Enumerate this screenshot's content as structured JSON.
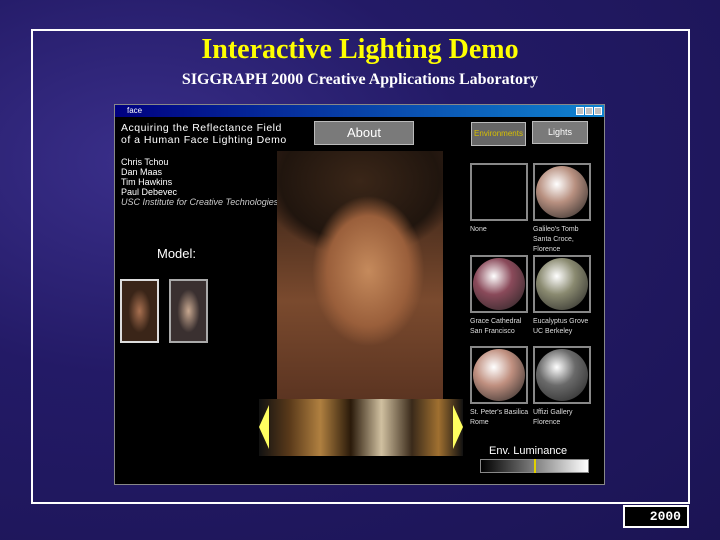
{
  "slide": {
    "title": "Interactive Lighting Demo",
    "subtitle": "SIGGRAPH 2000 Creative Applications Laboratory",
    "logo_text": "2000"
  },
  "window": {
    "title": "face",
    "app_title_1": "Acquiring the Reflectance Field",
    "app_title_2": "of a Human Face Lighting Demo",
    "authors": [
      "Chris Tchou",
      "Dan Maas",
      "Tim Hawkins",
      "Paul Debevec"
    ],
    "institution": "USC Institute for Creative Technologies",
    "about_label": "About",
    "model_label": "Model:",
    "tabs": {
      "environments": "Environments",
      "lights": "Lights",
      "active": "environments"
    },
    "environments": [
      {
        "line1": "None",
        "line2": "",
        "color": "#000000"
      },
      {
        "line1": "Galileo's Tomb",
        "line2": "Santa Croce, Florence",
        "color": "#b89080"
      },
      {
        "line1": "Grace Cathedral",
        "line2": "San Francisco",
        "color": "#8a4a5a"
      },
      {
        "line1": "Eucalyptus Grove",
        "line2": "UC Berkeley",
        "color": "#8a8a70"
      },
      {
        "line1": "St. Peter's Basilica",
        "line2": "Rome",
        "color": "#c09080"
      },
      {
        "line1": "Uffizi Gallery",
        "line2": "Florence",
        "color": "#6a6a6a"
      }
    ],
    "luminance_label": "Env. Luminance",
    "luminance_value": 0.5
  }
}
